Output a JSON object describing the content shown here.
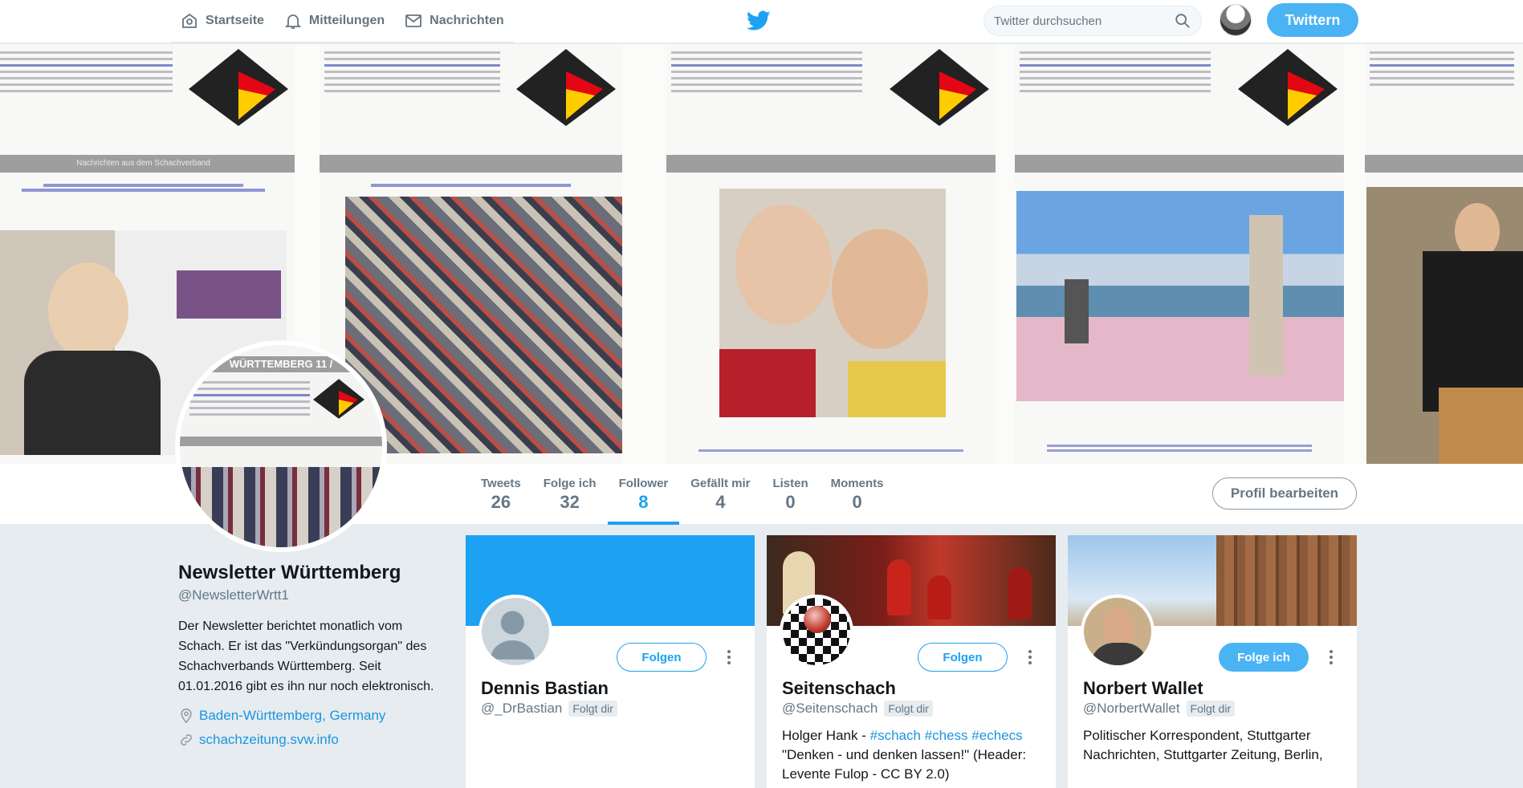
{
  "nav": {
    "items": [
      {
        "label": "Startseite",
        "icon": "home-icon"
      },
      {
        "label": "Mitteilungen",
        "icon": "bell-icon"
      },
      {
        "label": "Nachrichten",
        "icon": "envelope-icon"
      }
    ],
    "search_placeholder": "Twitter durchsuchen",
    "tweet_button": "Twittern",
    "accent": "#1da1f2"
  },
  "banner": {
    "newsletter_stripe": "Nachrichten aus dem Schachverband",
    "avatar_heading": "WÜRTTEMBERG 11 /"
  },
  "stats": [
    {
      "label": "Tweets",
      "value": "26"
    },
    {
      "label": "Folge ich",
      "value": "32"
    },
    {
      "label": "Follower",
      "value": "8"
    },
    {
      "label": "Gefällt mir",
      "value": "4"
    },
    {
      "label": "Listen",
      "value": "0"
    },
    {
      "label": "Moments",
      "value": "0"
    }
  ],
  "edit_profile_button": "Profil bearbeiten",
  "profile": {
    "name": "Newsletter Württemberg",
    "handle": "@NewsletterWrtt1",
    "bio": "Der Newsletter berichtet monatlich vom Schach. Er ist das \"Verkündungsorgan\" des Schachverbands Württemberg. Seit 01.01.2016 gibt es ihn nur noch elektronisch.",
    "location": "Baden-Württemberg, Germany",
    "website": "schachzeitung.svw.info"
  },
  "followers": [
    {
      "name": "Dennis Bastian",
      "handle": "@_DrBastian",
      "badge": "Folgt dir",
      "button": "Folgen",
      "bio_prefix": "",
      "tags": [],
      "bio_rest": ""
    },
    {
      "name": "Seitenschach",
      "handle": "@Seitenschach",
      "badge": "Folgt dir",
      "button": "Folgen",
      "bio_prefix": "Holger Hank - ",
      "tags": [
        "#schach",
        "#chess",
        "#echecs"
      ],
      "bio_rest": "\"Denken - und denken lassen!\" (Header: Levente Fulop - CC BY 2.0)"
    },
    {
      "name": "Norbert Wallet",
      "handle": "@NorbertWallet",
      "badge": "Folgt dir",
      "button": "Folge ich",
      "bio_prefix": "Politischer Korrespondent, Stuttgarter Nachrichten, Stuttgarter Zeitung, Berlin,",
      "tags": [],
      "bio_rest": ""
    }
  ]
}
